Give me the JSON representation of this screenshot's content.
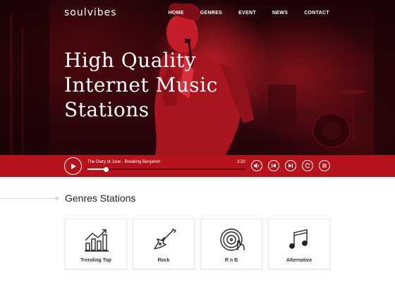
{
  "header": {
    "logo": "soulvibes",
    "nav": [
      "HOME",
      "GENRES",
      "EVENT",
      "NEWS",
      "CONTACT"
    ]
  },
  "hero": {
    "title_lines": [
      "High Quality",
      "Internet Music",
      "Stations"
    ]
  },
  "player": {
    "track": "The Diary of Jane - Breaking Benjamin",
    "time": "3:20",
    "progress": 0.12,
    "controls": [
      "volume-icon",
      "previous-icon",
      "next-icon",
      "repeat-icon",
      "playlist-icon"
    ]
  },
  "genres": {
    "title": "Genres Stations",
    "cards": [
      {
        "label": "Trending Top",
        "icon": "trending-chart-icon"
      },
      {
        "label": "Rock",
        "icon": "electric-guitar-icon"
      },
      {
        "label": "R n B",
        "icon": "vinyl-record-icon"
      },
      {
        "label": "Alternative",
        "icon": "music-notes-icon"
      }
    ]
  },
  "colors": {
    "accent": "#b5121b",
    "hero_dark": "#1a0306"
  }
}
